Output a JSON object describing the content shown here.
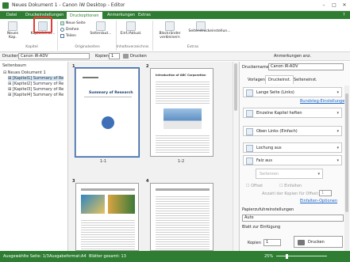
{
  "window": {
    "title": "Neues Dokument 1 - Canon iW Desktop - Editor",
    "minimize": "–",
    "maximize": "□",
    "close": "✕"
  },
  "menu": {
    "tabs": [
      "Datei",
      "Druckeinstellungen",
      "Druckoptionen",
      "Anmerkungen",
      "Extras"
    ],
    "active_index": 2,
    "help": "?"
  },
  "ribbon": {
    "new_chapter": "Neues Kap.",
    "chapter_props": "Kapiteleinst...",
    "group_chapter": "Kapitel",
    "new_page": "Neue Seite",
    "rotate": "Drehen",
    "split": "Teilen",
    "page_settings": "Seitenlaut...",
    "group_original": "Originalseiten",
    "toc_insert": "Einf./Aktual.",
    "group_toc": "Inhaltsverzeichnis",
    "blank_remove": "Blockränder verkleinern",
    "page_number_settings": "Seitendruckeinstellun...",
    "group_extras": "Extras"
  },
  "toolbar": {
    "printer_label": "Drucker",
    "printer_value": "Canon iR-ADV",
    "copies_label": "Kopien",
    "copies_value": "1",
    "print_button": "Drucken",
    "annot_label": "Anmerkungen anz."
  },
  "tree": {
    "title": "Seitenbaum",
    "items": [
      "Neues Dokument 1",
      "[Kapitel1] Summary of Re",
      "[Kapitel2] Summary of Re",
      "[Kapitel3] Summary of Re",
      "[Kapitel4] Summary of Re"
    ]
  },
  "pages": [
    {
      "num": "1",
      "label": "1-1",
      "heading": "Summary of Research"
    },
    {
      "num": "2",
      "label": "1-2",
      "heading": "Introduction of ABC Corporation"
    },
    {
      "num": "3",
      "label": "",
      "heading": ""
    },
    {
      "num": "4",
      "label": "",
      "heading": ""
    }
  ],
  "right": {
    "printer_label": "Druckername:",
    "printer_value": "Canon iR-ADV",
    "tabs": [
      "Vorlagen",
      "Druckeinst.",
      "Seiteneinst."
    ],
    "rows": [
      "Lange Seite (Links)",
      "Einzelne Kapitel heften",
      "Oben Links (Einfach)",
      "Lochung aus",
      "Falz aus",
      "Seitenren"
    ],
    "link1": "Bundsteg-Einstellungen",
    "offset": "Offset",
    "staple": "Einfalten",
    "offset_count_label": "Anzahl der Kopien für Offset:",
    "offset_count": "1",
    "link2": "Einfalten-Optionen",
    "paper_section": "Papierzufuhreinstellungen",
    "paper_value": "Auto",
    "sheet_label": "Blatt zur Einfügung",
    "copies_label": "Kopien",
    "copies_value": "1",
    "print_button": "Drucken"
  },
  "status": {
    "selected_page": "Ausgewählte Seite: 1/3",
    "output_format": "Ausgabeformat:A4",
    "sheets": "Blätter gesamt: 13",
    "zoom": "25%"
  }
}
